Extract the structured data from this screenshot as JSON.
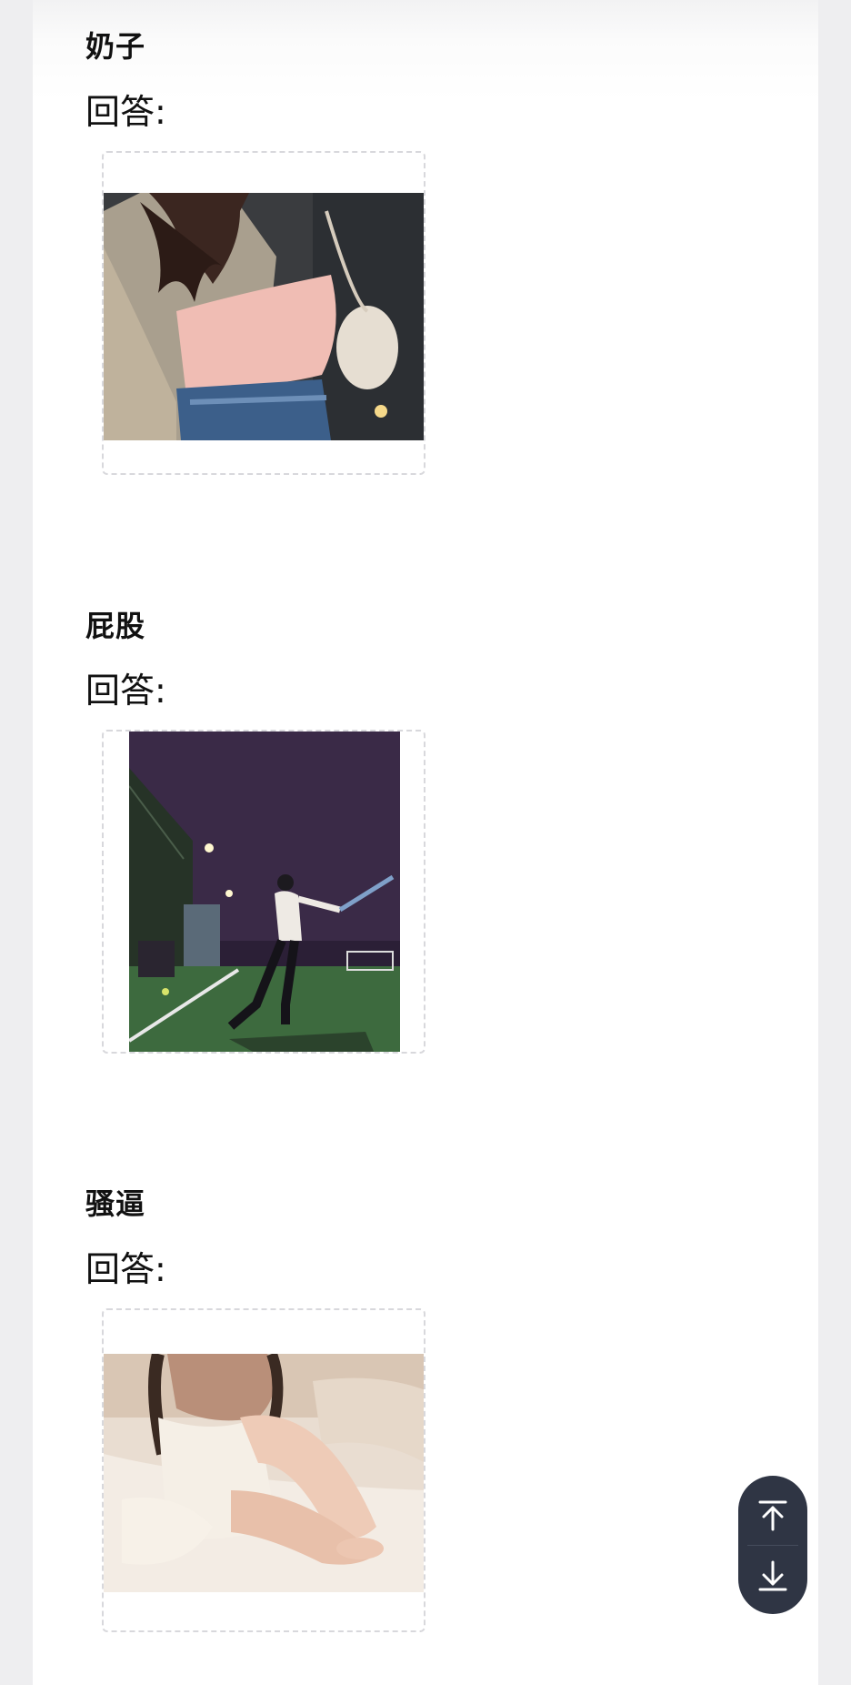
{
  "sections": [
    {
      "title": "奶子",
      "answer_label": "回答:",
      "image": "pink camisole photo"
    },
    {
      "title": "屁股",
      "answer_label": "回答:",
      "image": "night baseball field photo"
    },
    {
      "title": "骚逼",
      "answer_label": "回答:",
      "image": "woman seated on bed photo"
    }
  ],
  "scroll_controls": {
    "top_icon": "arrow-to-top-icon",
    "bottom_icon": "arrow-to-bottom-icon"
  },
  "colors": {
    "background": "#eeeef0",
    "card": "#ffffff",
    "widget": "#2f3544",
    "frame_border": "#d8d8dc"
  }
}
